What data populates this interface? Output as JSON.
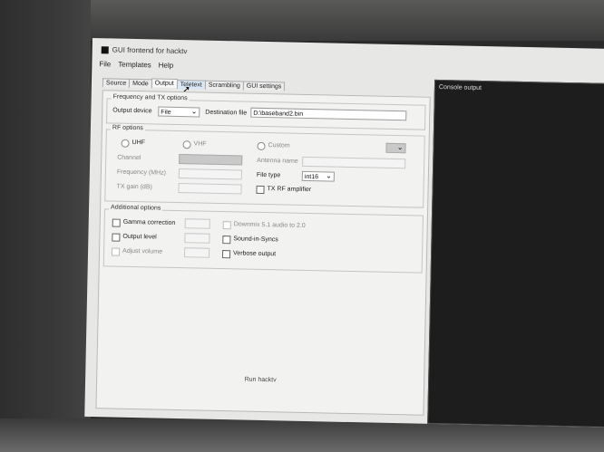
{
  "window": {
    "title": "GUI frontend for hacktv"
  },
  "menu": [
    "File",
    "Templates",
    "Help"
  ],
  "tabs": [
    "Source",
    "Mode",
    "Output",
    "Teletext",
    "Scrambling",
    "GUI settings"
  ],
  "freq_tx": {
    "title": "Frequency and TX options",
    "output_device_label": "Output device",
    "output_device_value": "File",
    "dest_file_label": "Destination file",
    "dest_file_value": "D:\\baseband2.bin"
  },
  "rf": {
    "title": "RF options",
    "uhf": "UHF",
    "vhf": "VHF",
    "custom": "Custom",
    "channel": "Channel",
    "frequency": "Frequency (MHz)",
    "tx_gain": "TX gain (dB)",
    "antenna_name": "Antenna name",
    "file_type_label": "File type",
    "file_type_value": "int16",
    "tx_rf_amp": "TX RF amplifier"
  },
  "additional": {
    "title": "Additional options",
    "gamma": "Gamma correction",
    "output_level": "Output level",
    "adjust_volume": "Adjust volume",
    "downmix": "Downmix 5.1 audio to 2.0",
    "sound_in_syncs": "Sound-in-Syncs",
    "verbose": "Verbose output"
  },
  "run_button": "Run hacktv",
  "console": {
    "title": "Console output"
  }
}
